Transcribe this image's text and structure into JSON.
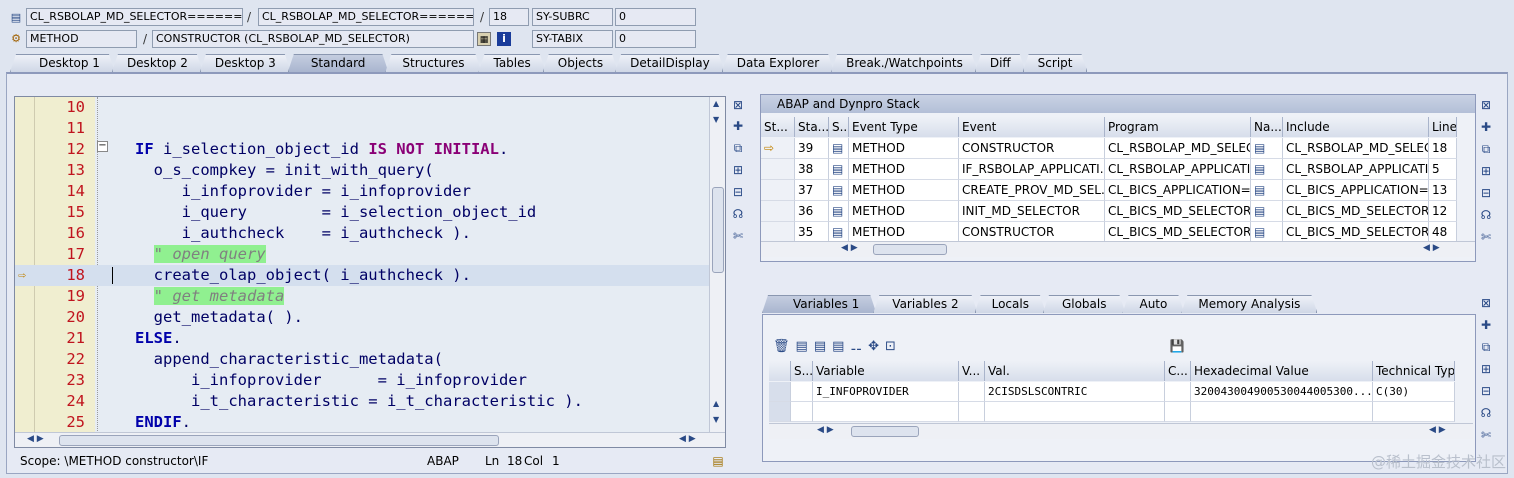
{
  "header": {
    "row1": {
      "field1": "CL_RSBOLAP_MD_SELECTOR=======...",
      "field2": "CL_RSBOLAP_MD_SELECTOR=======...",
      "line": "18",
      "sysvar": "SY-SUBRC",
      "sysval": "0"
    },
    "row2": {
      "field1": "METHOD",
      "field2": "CONSTRUCTOR (CL_RSBOLAP_MD_SELECTOR)",
      "sysvar": "SY-TABIX",
      "sysval": "0"
    },
    "sep": "/"
  },
  "tabs": [
    "Desktop 1",
    "Desktop 2",
    "Desktop 3",
    "Standard",
    "Structures",
    "Tables",
    "Objects",
    "DetailDisplay",
    "Data Explorer",
    "Break./Watchpoints",
    "Diff",
    "Script"
  ],
  "active_tab": "Standard",
  "code": {
    "lines": [
      {
        "n": "10",
        "text": ""
      },
      {
        "n": "11",
        "text": ""
      },
      {
        "n": "12",
        "text": "IF i_selection_object_id IS NOT INITIAL."
      },
      {
        "n": "13",
        "text": "  o_s_compkey = init_with_query("
      },
      {
        "n": "14",
        "text": "     i_infoprovider = i_infoprovider"
      },
      {
        "n": "15",
        "text": "     i_query        = i_selection_object_id"
      },
      {
        "n": "16",
        "text": "     i_authcheck    = i_authcheck )."
      },
      {
        "n": "17",
        "text": "  \" open query"
      },
      {
        "n": "18",
        "text": "  create_olap_object( i_authcheck )."
      },
      {
        "n": "19",
        "text": "  \" get metadata"
      },
      {
        "n": "20",
        "text": "  get_metadata( )."
      },
      {
        "n": "21",
        "text": "ELSE."
      },
      {
        "n": "22",
        "text": "  append_characteristic_metadata("
      },
      {
        "n": "23",
        "text": "      i_infoprovider      = i_infoprovider"
      },
      {
        "n": "24",
        "text": "      i_t_characteristic = i_t_characteristic )."
      },
      {
        "n": "25",
        "text": "ENDIF."
      }
    ],
    "current_line": "18"
  },
  "status": {
    "scope": "Scope: \\METHOD constructor\\IF",
    "lang": "ABAP",
    "ln_label": "Ln",
    "ln": "18",
    "col_label": "Col",
    "col": "1"
  },
  "stack": {
    "title": "ABAP and Dynpro Stack",
    "columns": [
      "St...",
      "Sta...",
      "S...",
      "Event Type",
      "Event",
      "Program",
      "Na...",
      "Include",
      "Line"
    ],
    "rows": [
      {
        "cur": true,
        "lvl": "39",
        "type": "METHOD",
        "event": "CONSTRUCTOR",
        "program": "CL_RSBOLAP_MD_SELEC...",
        "include": "CL_RSBOLAP_MD_SELEC...",
        "line": "18"
      },
      {
        "cur": false,
        "lvl": "38",
        "type": "METHOD",
        "event": "IF_RSBOLAP_APPLICATI...",
        "program": "CL_RSBOLAP_APPLICATI...",
        "include": "CL_RSBOLAP_APPLICATI...",
        "line": "5"
      },
      {
        "cur": false,
        "lvl": "37",
        "type": "METHOD",
        "event": "CREATE_PROV_MD_SEL...",
        "program": "CL_BICS_APPLICATION=...",
        "include": "CL_BICS_APPLICATION=...",
        "line": "13"
      },
      {
        "cur": false,
        "lvl": "36",
        "type": "METHOD",
        "event": "INIT_MD_SELECTOR",
        "program": "CL_BICS_MD_SELECTOR...",
        "include": "CL_BICS_MD_SELECTOR...",
        "line": "12"
      },
      {
        "cur": false,
        "lvl": "35",
        "type": "METHOD",
        "event": "CONSTRUCTOR",
        "program": "CL_BICS_MD_SELECTOR...",
        "include": "CL_BICS_MD_SELECTOR...",
        "line": "48"
      }
    ]
  },
  "var_tabs": [
    "Variables 1",
    "Variables 2",
    "Locals",
    "Globals",
    "Auto",
    "Memory Analysis"
  ],
  "vars": {
    "columns": [
      "S...",
      "Variable",
      "V...",
      "Val.",
      "C...",
      "Hexadecimal Value",
      "Technical Typ"
    ],
    "rows": [
      {
        "name": "I_INFOPROVIDER",
        "val": "2CISDSLSCONTRIC",
        "hex": "320043004900530044005300...",
        "type": "C(30)"
      }
    ]
  },
  "watermark": "@稀土掘金技术社区",
  "colors": {
    "keyword": "#0000aa",
    "keyword2": "#8a0076",
    "comment_bg": "#90f090",
    "line_number": "#c0141e"
  }
}
